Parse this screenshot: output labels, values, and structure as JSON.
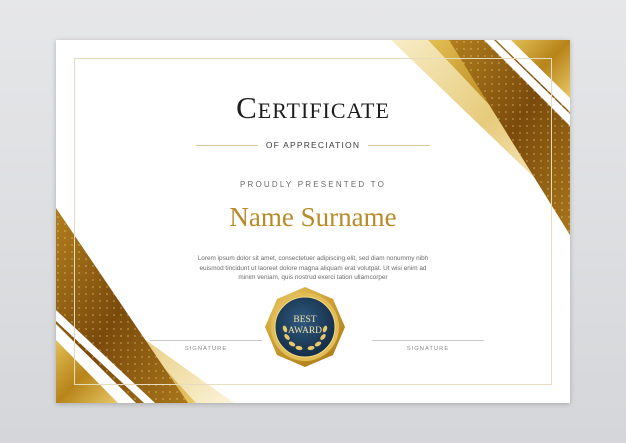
{
  "certificate": {
    "title": "Certificate",
    "subtitle": "OF APPRECIATION",
    "presented_label": "PROUDLY PRESENTED TO",
    "recipient_name": "Name Surname",
    "body_text": "Lorem ipsum dolor sit amet, consectetuer adipiscing elit, sed diam nonummy nibh euismod tincidunt ut laoreet dolore magna aliquam erat volutpat. Ut wisi enim ad minim veniam, quis nostrud exerci tation ullamcorper",
    "signature_left_label": "SIGNATURE",
    "signature_right_label": "SIGNATURE",
    "badge_line1": "BEST",
    "badge_line2": "AWARD"
  },
  "colors": {
    "gold": "#c9a233",
    "gold_dark": "#8a5a10",
    "gold_light": "#f3df93",
    "badge_navy": "#1d3a55",
    "name_gold": "#b88a28"
  }
}
